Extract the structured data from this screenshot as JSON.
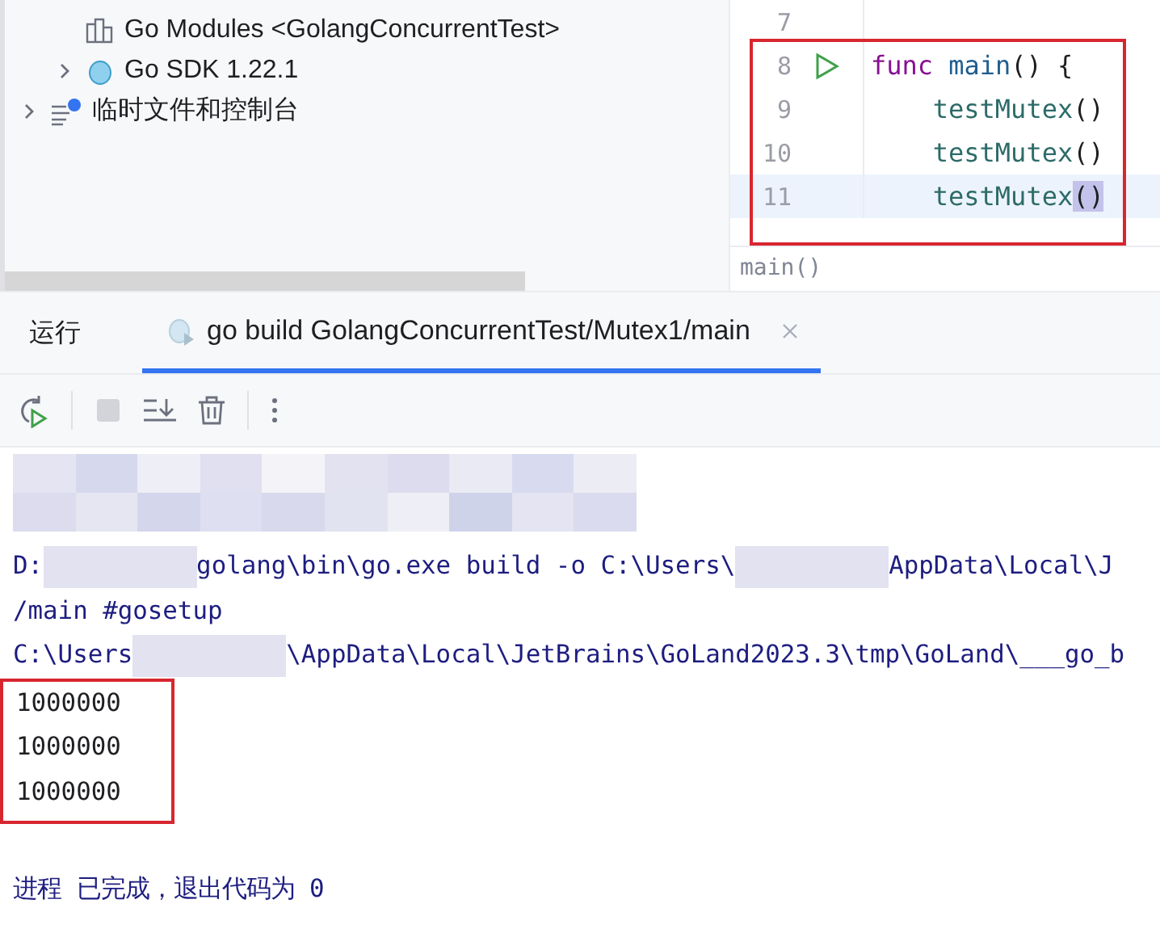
{
  "project_tree": {
    "items": [
      {
        "kind": "group",
        "children": [
          {
            "label": "Go Modules <GolangConcurrentTest>",
            "kind": "modules"
          },
          {
            "label": "Go SDK 1.22.1",
            "kind": "sdk",
            "expanded": false
          }
        ]
      },
      {
        "label": "临时文件和控制台",
        "kind": "scratches",
        "expanded": false
      }
    ]
  },
  "editor": {
    "annotated": true,
    "lines": [
      {
        "number": "7"
      },
      {
        "number": "8",
        "run": true,
        "tokens": [
          {
            "kind": "keyword",
            "text": "func"
          },
          {
            "kind": "function",
            "text": "main"
          },
          {
            "kind": "plain",
            "text": "() {"
          }
        ]
      },
      {
        "number": "9",
        "indented": true,
        "tokens": [
          {
            "kind": "call",
            "text": "testMutex"
          },
          {
            "kind": "plain",
            "text": "()"
          }
        ]
      },
      {
        "number": "10",
        "indented": true,
        "tokens": [
          {
            "kind": "call",
            "text": "testMutex"
          },
          {
            "kind": "plain",
            "text": "()"
          }
        ]
      },
      {
        "number": "11",
        "current": true,
        "indented": true,
        "tokens": [
          {
            "kind": "call",
            "text": "testMutex"
          },
          {
            "kind": "match",
            "text": "()"
          }
        ]
      }
    ],
    "breadcrumb": "main()"
  },
  "run_panel": {
    "title": "运行",
    "tabs": [
      {
        "label": "go build GolangConcurrentTest/Mutex1/main",
        "selected": true,
        "closable": true
      }
    ],
    "toolbar": [
      {
        "kind": "rerun",
        "disabled": false
      },
      {
        "kind": "separator"
      },
      {
        "kind": "stop",
        "disabled": true
      },
      {
        "kind": "scroll-end",
        "disabled": false
      },
      {
        "kind": "clear",
        "disabled": false
      },
      {
        "kind": "separator"
      },
      {
        "kind": "more",
        "disabled": false
      }
    ],
    "console": [
      {
        "kind": "redacted"
      },
      {
        "kind": "command",
        "segments": [
          {
            "kind": "text",
            "text": "D:"
          },
          {
            "kind": "redacted"
          },
          {
            "kind": "text",
            "text": "golang\\bin\\go.exe build -o C:\\Users\\"
          },
          {
            "kind": "redacted"
          },
          {
            "kind": "text",
            "text": "AppData\\Local\\J"
          }
        ]
      },
      {
        "kind": "command",
        "segments": [
          {
            "kind": "text",
            "text": "/main #gosetup"
          }
        ]
      },
      {
        "kind": "command",
        "segments": [
          {
            "kind": "text",
            "text": "C:\\Users"
          },
          {
            "kind": "redacted"
          },
          {
            "kind": "text",
            "text": "\\AppData\\Local\\JetBrains\\GoLand2023.3\\tmp\\GoLand\\___go_b"
          }
        ]
      },
      {
        "kind": "output",
        "annotated": true,
        "segments": [
          {
            "kind": "text",
            "text": "1000000"
          }
        ]
      },
      {
        "kind": "output",
        "annotated": true,
        "segments": [
          {
            "kind": "text",
            "text": "1000000"
          }
        ]
      },
      {
        "kind": "output",
        "annotated": true,
        "segments": [
          {
            "kind": "text",
            "text": "1000000"
          }
        ]
      },
      {
        "kind": "blank"
      },
      {
        "kind": "exit",
        "segments": [
          {
            "kind": "text",
            "text": "进程 已完成，退出代码为 0"
          }
        ]
      }
    ]
  }
}
